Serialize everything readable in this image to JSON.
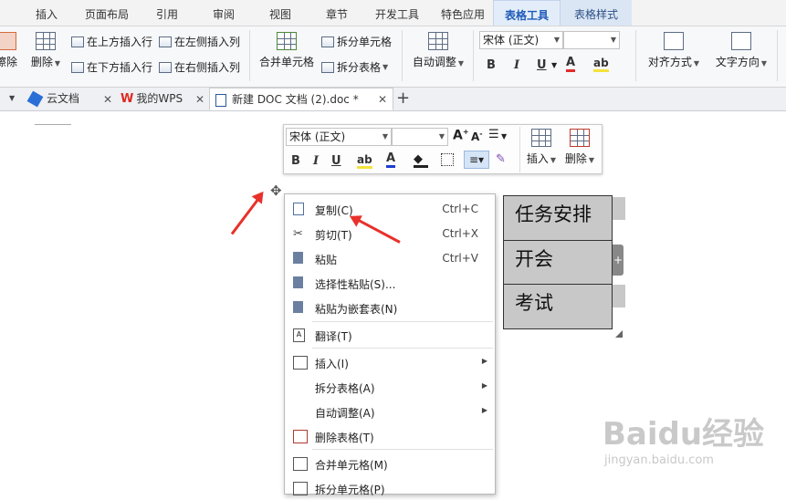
{
  "menu_tabs": [
    {
      "label": "插入"
    },
    {
      "label": "页面布局"
    },
    {
      "label": "引用"
    },
    {
      "label": "审阅"
    },
    {
      "label": "视图"
    },
    {
      "label": "章节"
    },
    {
      "label": "开发工具"
    },
    {
      "label": "特色应用"
    },
    {
      "label": "表格工具"
    },
    {
      "label": "表格样式"
    }
  ],
  "ribbon": {
    "erase_label": "擦除",
    "delete_label": "删除",
    "insert_above": "在上方插入行",
    "insert_below": "在下方插入行",
    "insert_left": "在左侧插入列",
    "insert_right": "在右侧插入列",
    "merge_cells": "合并单元格",
    "split_cells": "拆分单元格",
    "split_table": "拆分表格",
    "auto_fit": "自动调整",
    "font_name": "宋体 (正文)",
    "font_size": "",
    "align": "对齐方式",
    "text_dir": "文字方向"
  },
  "doc_tabs": [
    {
      "label": "云文档"
    },
    {
      "label": "我的WPS"
    },
    {
      "label": "新建 DOC 文档 (2).doc *"
    }
  ],
  "mini_toolbar": {
    "font_name": "宋体 (正文)",
    "font_size": "",
    "insert_label": "插入",
    "delete_label": "删除"
  },
  "table": {
    "cells": [
      "任务安排",
      "开会",
      "考试"
    ]
  },
  "context_menu": {
    "items": [
      {
        "label": "复制(C)",
        "shortcut": "Ctrl+C"
      },
      {
        "label": "剪切(T)",
        "shortcut": "Ctrl+X"
      },
      {
        "label": "粘贴",
        "shortcut": "Ctrl+V"
      },
      {
        "label": "选择性粘贴(S)...",
        "shortcut": ""
      },
      {
        "label": "粘贴为嵌套表(N)",
        "shortcut": ""
      },
      {
        "label": "翻译(T)",
        "shortcut": ""
      },
      {
        "label": "插入(I)",
        "shortcut": ""
      },
      {
        "label": "拆分表格(A)",
        "shortcut": ""
      },
      {
        "label": "自动调整(A)",
        "shortcut": ""
      },
      {
        "label": "删除表格(T)",
        "shortcut": ""
      },
      {
        "label": "合并单元格(M)",
        "shortcut": ""
      },
      {
        "label": "拆分单元格(P)",
        "shortcut": ""
      }
    ]
  },
  "watermark": {
    "brand": "Baidu经验",
    "url": "jingyan.baidu.com"
  },
  "colors": {
    "accent": "#1e5bb8",
    "arrow": "#e8312a",
    "cell_fill": "#c8c8c8"
  }
}
